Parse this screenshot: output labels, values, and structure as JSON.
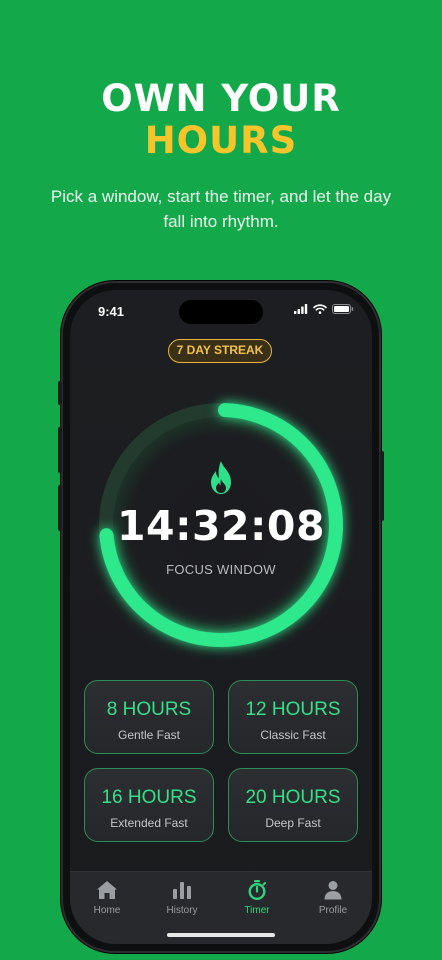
{
  "hero": {
    "line1": "OWN YOUR",
    "line2": "HOURS",
    "subtitle": "Pick a window, start the timer, and let the day fall into rhythm."
  },
  "status_bar": {
    "time": "9:41"
  },
  "streak": {
    "label": "7 DAY STREAK"
  },
  "timer": {
    "value": "14:32:08",
    "label": "FOCUS WINDOW",
    "icon": "flame-icon",
    "progress": 0.73
  },
  "plans": [
    {
      "name": "8 HOURS",
      "description": "Gentle Fast"
    },
    {
      "name": "12 HOURS",
      "description": "Classic Fast"
    },
    {
      "name": "16 HOURS",
      "description": "Extended Fast"
    },
    {
      "name": "20 HOURS",
      "description": "Deep Fast"
    }
  ],
  "tabs": [
    {
      "label": "Home",
      "icon": "home-icon"
    },
    {
      "label": "History",
      "icon": "bar-chart-icon"
    },
    {
      "label": "Timer",
      "icon": "stopwatch-icon",
      "active": true
    },
    {
      "label": "Profile",
      "icon": "person-icon"
    }
  ],
  "colors": {
    "background": "#13a94a",
    "accent": "#2fe08a",
    "highlight": "#f6c52b"
  }
}
